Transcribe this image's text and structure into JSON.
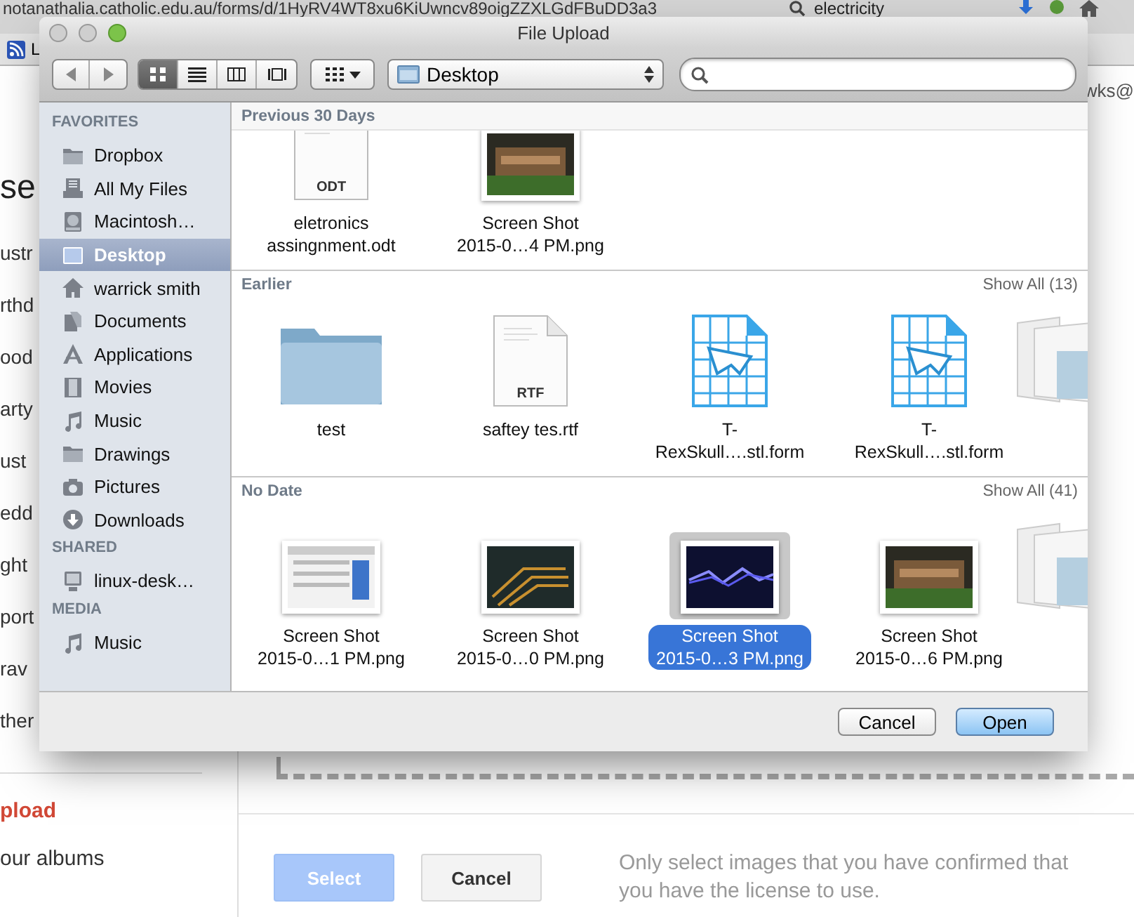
{
  "browser": {
    "address": "notanathalia.catholic.edu.au/forms/d/1HyRV4WT8xu6KiUwncv89oigZZXLGdFBuDD3a3",
    "search": "electricity",
    "bookmark": "L",
    "account": "wks@"
  },
  "page": {
    "heading": "se",
    "nav": [
      "ustr",
      "rthd",
      "ood",
      "arty",
      "ust",
      "edd",
      "ght",
      "port",
      "rav",
      "ther"
    ],
    "upload_tab": "pload",
    "albums_tab": "our albums",
    "buttons": [
      {
        "label": "Select",
        "disabled": true
      },
      {
        "label": "Cancel",
        "disabled": false
      }
    ],
    "note": "Only select images that you have confirmed that you have the license to use."
  },
  "dialog": {
    "title": "File Upload",
    "views": [
      {
        "kind": "icons",
        "selected": true
      },
      {
        "kind": "list",
        "selected": false
      },
      {
        "kind": "columns",
        "selected": false
      },
      {
        "kind": "coverflow",
        "selected": false
      }
    ],
    "location": "Desktop",
    "sidebar": [
      {
        "heading": "FAVORITES",
        "items": [
          {
            "label": "Dropbox",
            "kind": "folder",
            "selected": false
          },
          {
            "label": "All My Files",
            "kind": "files",
            "selected": false
          },
          {
            "label": "Macintosh…",
            "kind": "disk",
            "selected": false
          },
          {
            "label": "Desktop",
            "kind": "desktop",
            "selected": true
          },
          {
            "label": "warrick smith",
            "kind": "home",
            "selected": false
          },
          {
            "label": "Documents",
            "kind": "documents",
            "selected": false
          },
          {
            "label": "Applications",
            "kind": "applications",
            "selected": false
          },
          {
            "label": "Movies",
            "kind": "movies",
            "selected": false
          },
          {
            "label": "Music",
            "kind": "music",
            "selected": false
          },
          {
            "label": "Drawings",
            "kind": "folder",
            "selected": false
          },
          {
            "label": "Pictures",
            "kind": "pictures",
            "selected": false
          },
          {
            "label": "Downloads",
            "kind": "downloads",
            "selected": false
          }
        ]
      },
      {
        "heading": "SHARED",
        "items": [
          {
            "label": "linux-desk…",
            "kind": "computer",
            "selected": false
          }
        ]
      },
      {
        "heading": "MEDIA",
        "items": [
          {
            "label": "Music",
            "kind": "music",
            "selected": false
          }
        ]
      }
    ],
    "sections": [
      {
        "heading": "Previous 30 Days",
        "items": [
          {
            "kind": "document",
            "badge": "ODT",
            "lines": [
              "eletronics",
              "assingnment.odt"
            ],
            "selected": false
          },
          {
            "lines": [
              "Screen Shot",
              "2015-0…4 PM.png"
            ],
            "selected": false
          }
        ]
      },
      {
        "heading": "Earlier",
        "show_all": "Show All (13)",
        "items": [
          {
            "kind": "folder",
            "lines": [
              "test"
            ],
            "selected": false
          },
          {
            "kind": "document",
            "badge": "RTF",
            "lines": [
              "saftey tes.rtf"
            ],
            "selected": false
          },
          {
            "kind": "form",
            "lines": [
              "T-",
              "RexSkull….stl.form"
            ],
            "selected": false
          },
          {
            "kind": "form",
            "lines": [
              "T-",
              "RexSkull….stl.form"
            ],
            "selected": false
          },
          {
            "kind": "stack"
          }
        ]
      },
      {
        "heading": "No Date",
        "show_all": "Show All (41)",
        "items": [
          {
            "lines": [
              "Screen Shot",
              "2015-0…1 PM.png"
            ],
            "selected": false
          },
          {
            "lines": [
              "Screen Shot",
              "2015-0…0 PM.png"
            ],
            "selected": false
          },
          {
            "lines": [
              "Screen Shot",
              "2015-0…3 PM.png"
            ],
            "selected": true
          },
          {
            "lines": [
              "Screen Shot",
              "2015-0…6 PM.png"
            ],
            "selected": false
          },
          {
            "kind": "stack"
          }
        ]
      }
    ],
    "buttons": [
      {
        "label": "Cancel",
        "default": false
      },
      {
        "label": "Open",
        "default": true
      }
    ]
  }
}
